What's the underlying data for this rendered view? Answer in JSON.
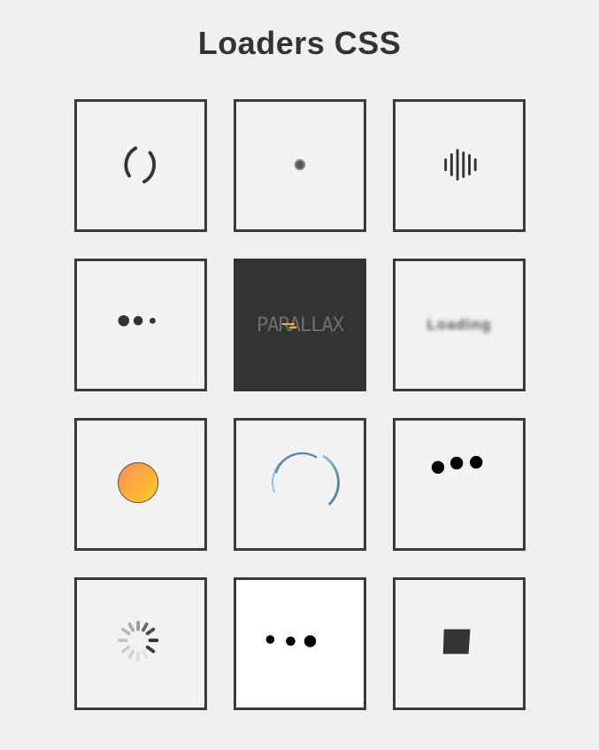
{
  "page": {
    "title": "Loaders CSS"
  },
  "loaders": [
    {
      "id": "spinner-arc"
    },
    {
      "id": "pulse-dot"
    },
    {
      "id": "sound-bars"
    },
    {
      "id": "dots-shrinking"
    },
    {
      "id": "scramble-text",
      "text": "PARALLAX"
    },
    {
      "id": "blur-text",
      "text": "Loading"
    },
    {
      "id": "gradient-orb"
    },
    {
      "id": "double-arc"
    },
    {
      "id": "bouncing-dots"
    },
    {
      "id": "spoke-spinner"
    },
    {
      "id": "growing-dots"
    },
    {
      "id": "trapezoid"
    }
  ],
  "colors": {
    "background": "#f0f0f0",
    "cell_border": "#3a3a3a",
    "dark": "#333333",
    "orb_from": "#ff9a56",
    "orb_to": "#ffc31a",
    "arc_blue": "#5b87a8",
    "arc_light_blue": "#8fc1e0",
    "accent_yellow": "#f2b316"
  }
}
